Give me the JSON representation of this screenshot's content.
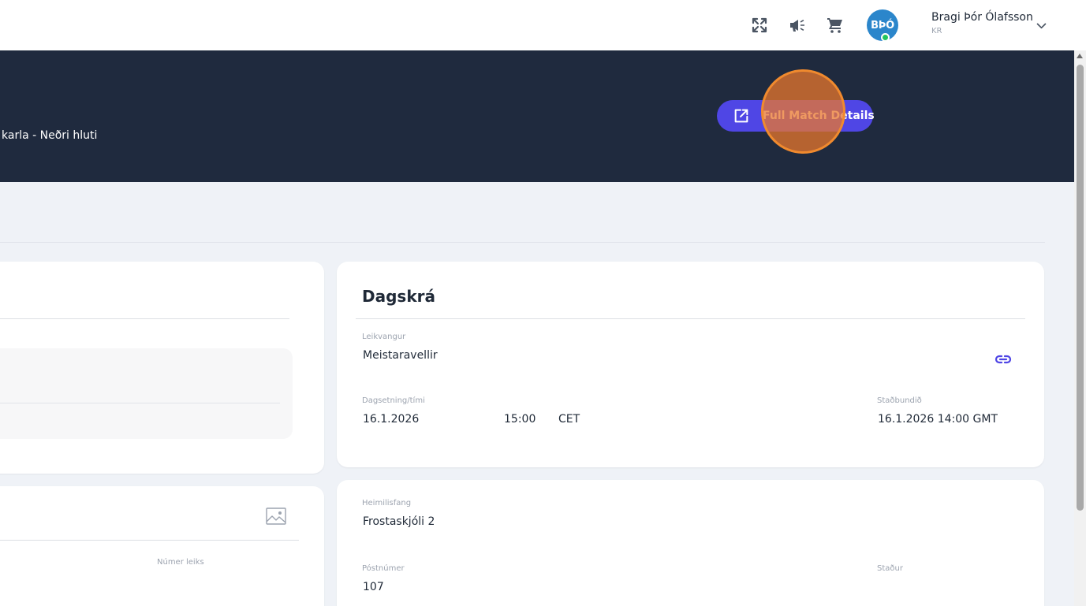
{
  "topbar": {
    "icons": [
      "fullscreen-icon",
      "megaphone-icon",
      "cart-icon"
    ],
    "avatar_initials": "BÞÓ",
    "user_name": "Bragi Þór Ólafsson",
    "user_club": "KR"
  },
  "hero": {
    "subtitle": "karla - Neðri hluti",
    "full_match_button": "Full Match Details"
  },
  "left_panel": {
    "match_number_label": "Númer leiks"
  },
  "schedule": {
    "title": "Dagskrá",
    "venue_label": "Leikvangur",
    "venue": "Meistaravellir",
    "datetime_label": "Dagsetning/tími",
    "date": "16.1.2026",
    "time": "15:00",
    "timezone": "CET",
    "local_label": "Staðbundið",
    "local_value": "16.1.2026 14:00 GMT"
  },
  "address": {
    "address_label": "Heimilisfang",
    "address": "Frostaskjóli 2",
    "postcode_label": "Póstnúmer",
    "postcode": "107",
    "place_label": "Staður"
  },
  "colors": {
    "accent": "#4f46e5",
    "hero_bg": "#1f2a3e",
    "avatar": "#2b86cb",
    "online": "#22c55e",
    "click_marker": "#f08a2e"
  }
}
